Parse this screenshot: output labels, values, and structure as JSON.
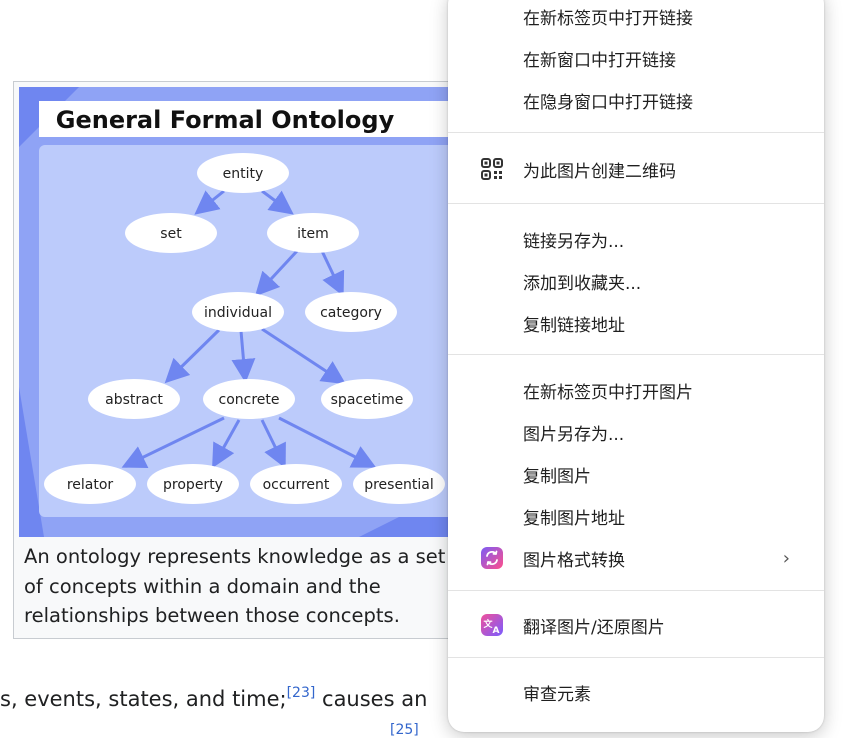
{
  "article": {
    "caption": "An ontology represents knowledge as a set of concepts within a domain and the relationships between those concepts.",
    "body_line_start": "s, events, states, and time;",
    "body_ref": "[23]",
    "body_line_end": " causes an",
    "cut_ref": "[25]"
  },
  "diagram": {
    "title": "General Formal Ontology",
    "nodes": {
      "entity": "entity",
      "set": "set",
      "item": "item",
      "individual": "individual",
      "category": "category",
      "abstract": "abstract",
      "concrete": "concrete",
      "spacetime": "spacetime",
      "relator": "relator",
      "property": "property",
      "occurrent": "occurrent",
      "presential": "presential"
    }
  },
  "context_menu": {
    "open_link_new_tab": "在新标签页中打开链接",
    "open_link_new_window": "在新窗口中打开链接",
    "open_link_incognito": "在隐身窗口中打开链接",
    "create_qr": "为此图片创建二维码",
    "save_link_as": "链接另存为...",
    "add_to_favorites": "添加到收藏夹...",
    "copy_link_address": "复制链接地址",
    "open_image_new_tab": "在新标签页中打开图片",
    "save_image_as": "图片另存为...",
    "copy_image": "复制图片",
    "copy_image_address": "复制图片地址",
    "image_format_convert": "图片格式转换",
    "translate_image": "翻译图片/还原图片",
    "inspect": "审查元素",
    "icons": {
      "qr": "qr-code-icon",
      "convert": "image-convert-icon",
      "translate": "translate-icon",
      "submenu": "chevron-right-icon"
    },
    "colors": {
      "convert_grad_a": "#7b5cf5",
      "convert_grad_b": "#ff4f8b",
      "translate_grad_a": "#f0509a",
      "translate_grad_b": "#7a5cff"
    }
  }
}
